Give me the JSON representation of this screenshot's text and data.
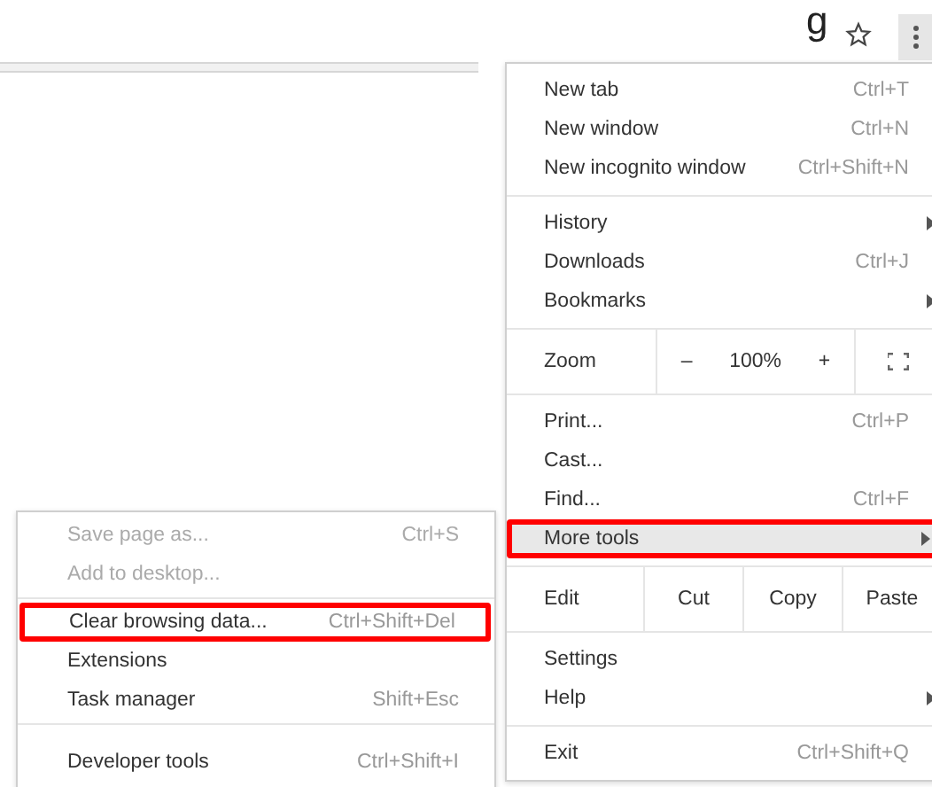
{
  "page_heading_fragment": "g",
  "toolbar": {
    "bookmark_star": true
  },
  "main_menu": {
    "sections": [
      [
        {
          "kind": "item",
          "label": "New tab",
          "shortcut": "Ctrl+T",
          "submenu": false,
          "selected": false,
          "outlined": false
        },
        {
          "kind": "item",
          "label": "New window",
          "shortcut": "Ctrl+N",
          "submenu": false,
          "selected": false,
          "outlined": false
        },
        {
          "kind": "item",
          "label": "New incognito window",
          "shortcut": "Ctrl+Shift+N",
          "submenu": false,
          "selected": false,
          "outlined": false
        }
      ],
      [
        {
          "kind": "item",
          "label": "History",
          "submenu": true,
          "selected": false,
          "outlined": false
        },
        {
          "kind": "item",
          "label": "Downloads",
          "shortcut": "Ctrl+J",
          "submenu": false,
          "selected": false,
          "outlined": false
        },
        {
          "kind": "item",
          "label": "Bookmarks",
          "submenu": true,
          "selected": false,
          "outlined": false
        }
      ],
      [
        {
          "kind": "zoom",
          "label": "Zoom",
          "minus": "–",
          "value": "100%",
          "plus": "+"
        }
      ],
      [
        {
          "kind": "item",
          "label": "Print...",
          "shortcut": "Ctrl+P",
          "submenu": false,
          "selected": false,
          "outlined": false
        },
        {
          "kind": "item",
          "label": "Cast...",
          "submenu": false,
          "selected": false,
          "outlined": false
        },
        {
          "kind": "item",
          "label": "Find...",
          "shortcut": "Ctrl+F",
          "submenu": false,
          "selected": false,
          "outlined": false
        },
        {
          "kind": "item",
          "label": "More tools",
          "submenu": true,
          "selected": true,
          "outlined": true
        }
      ],
      [
        {
          "kind": "edit",
          "label": "Edit",
          "buttons": [
            "Cut",
            "Copy",
            "Paste"
          ]
        }
      ],
      [
        {
          "kind": "item",
          "label": "Settings",
          "submenu": false,
          "selected": false,
          "outlined": false
        },
        {
          "kind": "item",
          "label": "Help",
          "submenu": true,
          "selected": false,
          "outlined": false
        }
      ],
      [
        {
          "kind": "item",
          "label": "Exit",
          "shortcut": "Ctrl+Shift+Q",
          "submenu": false,
          "selected": false,
          "outlined": false
        }
      ]
    ]
  },
  "more_tools_menu": {
    "sections": [
      [
        {
          "label": "Save page as...",
          "shortcut": "Ctrl+S",
          "disabled": true,
          "outlined": false
        },
        {
          "label": "Add to desktop...",
          "disabled": true,
          "outlined": false
        }
      ],
      [
        {
          "label": "Clear browsing data...",
          "shortcut": "Ctrl+Shift+Del",
          "disabled": false,
          "outlined": true
        },
        {
          "label": "Extensions",
          "disabled": false,
          "outlined": false
        },
        {
          "label": "Task manager",
          "shortcut": "Shift+Esc",
          "disabled": false,
          "outlined": false
        }
      ],
      [
        {
          "label": "Developer tools",
          "shortcut": "Ctrl+Shift+I",
          "disabled": false,
          "outlined": false
        }
      ]
    ]
  }
}
